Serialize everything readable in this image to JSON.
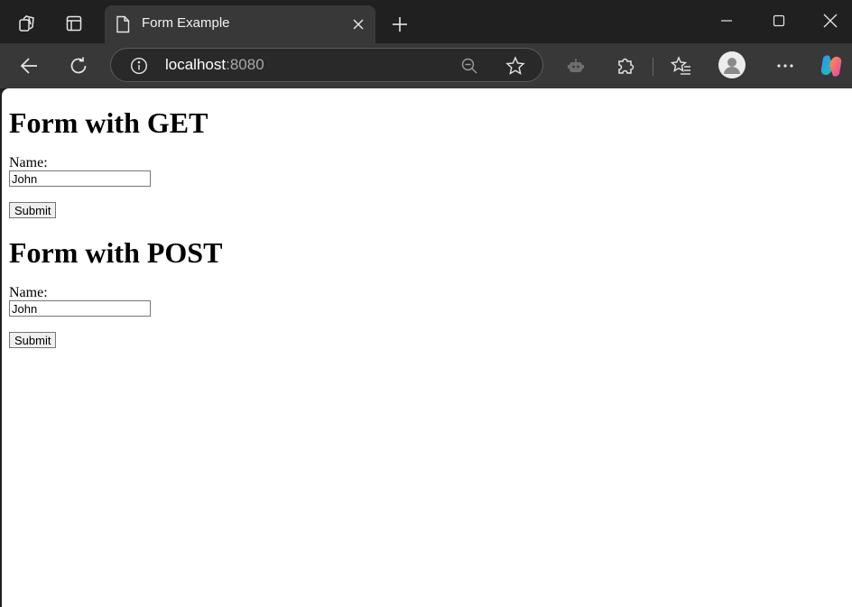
{
  "browser": {
    "tab": {
      "title": "Form Example"
    },
    "address_bar": {
      "host": "localhost",
      "port": ":8080"
    },
    "icons": {
      "workspaces": "workspaces-icon",
      "vertical_tabs": "vertical-tabs-icon",
      "page": "page-icon",
      "close": "close-icon",
      "new_tab": "plus-icon",
      "minimize": "minimize-icon",
      "maximize": "maximize-icon",
      "window_close": "window-close-icon",
      "back": "back-arrow-icon",
      "refresh": "refresh-icon",
      "info": "info-icon",
      "zoom": "zoom-out-icon",
      "favorite": "star-icon",
      "copilot_bot": "bot-icon",
      "extensions": "puzzle-icon",
      "favorites": "favorites-icon",
      "profile": "profile-icon",
      "more": "more-icon",
      "copilot": "copilot-icon"
    }
  },
  "page": {
    "get_form": {
      "heading": "Form with GET",
      "label": "Name:",
      "value": "John",
      "submit": "Submit"
    },
    "post_form": {
      "heading": "Form with POST",
      "label": "Name:",
      "value": "John",
      "submit": "Submit"
    }
  }
}
